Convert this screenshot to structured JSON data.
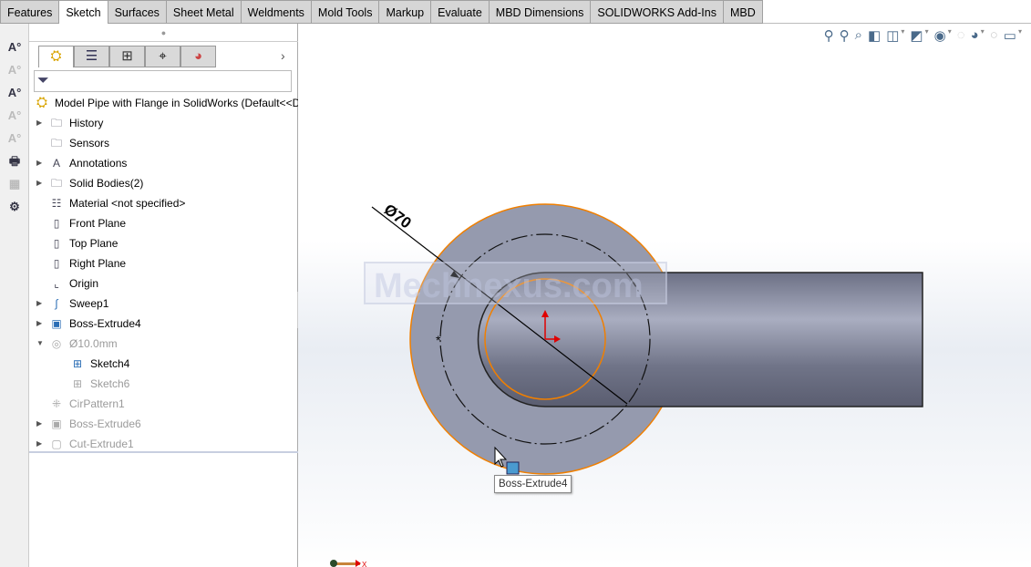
{
  "tabs": [
    "Features",
    "Sketch",
    "Surfaces",
    "Sheet Metal",
    "Weldments",
    "Mold Tools",
    "Markup",
    "Evaluate",
    "MBD Dimensions",
    "SOLIDWORKS Add-Ins",
    "MBD"
  ],
  "active_tab": "Sketch",
  "left_toolbar": [
    "smart-dimension-icon",
    "auto-dimension-icon",
    "import-annotations-icon",
    "annotation-icon",
    "note-icon",
    "print-icon",
    "datum-icon",
    "tolerance-icon"
  ],
  "panel_tabs": [
    "featuremanager-icon",
    "propertymanager-icon",
    "configurationmanager-icon",
    "dimxpertmanager-icon",
    "displaymanager-icon"
  ],
  "tree": {
    "root": "Model Pipe with Flange in SolidWorks  (Default<<D",
    "items": [
      {
        "label": "History",
        "icon": "history-folder-icon",
        "expand": true,
        "grey": false,
        "indent": 0
      },
      {
        "label": "Sensors",
        "icon": "sensors-folder-icon",
        "expand": false,
        "grey": false,
        "indent": 0
      },
      {
        "label": "Annotations",
        "icon": "annotations-folder-icon",
        "expand": true,
        "grey": false,
        "indent": 0
      },
      {
        "label": "Solid Bodies(2)",
        "icon": "solid-bodies-folder-icon",
        "expand": true,
        "grey": false,
        "indent": 0
      },
      {
        "label": "Material <not specified>",
        "icon": "material-icon",
        "expand": false,
        "grey": false,
        "indent": 0
      },
      {
        "label": "Front Plane",
        "icon": "plane-icon",
        "expand": false,
        "grey": false,
        "indent": 0
      },
      {
        "label": "Top Plane",
        "icon": "plane-icon",
        "expand": false,
        "grey": false,
        "indent": 0
      },
      {
        "label": "Right Plane",
        "icon": "plane-icon",
        "expand": false,
        "grey": false,
        "indent": 0
      },
      {
        "label": "Origin",
        "icon": "origin-icon",
        "expand": false,
        "grey": false,
        "indent": 0
      },
      {
        "label": "Sweep1",
        "icon": "sweep-icon",
        "expand": true,
        "grey": false,
        "indent": 0
      },
      {
        "label": "Boss-Extrude4",
        "icon": "extrude-icon",
        "expand": true,
        "grey": false,
        "indent": 0
      },
      {
        "label": "Ø10.0mm",
        "icon": "hole-icon",
        "expand": true,
        "grey": true,
        "indent": 0
      },
      {
        "label": "Sketch4",
        "icon": "sketch-icon",
        "expand": false,
        "grey": false,
        "indent": 1
      },
      {
        "label": "Sketch6",
        "icon": "sketch-icon",
        "expand": false,
        "grey": true,
        "indent": 1
      },
      {
        "label": "CirPattern1",
        "icon": "circular-pattern-icon",
        "expand": false,
        "grey": true,
        "indent": 0
      },
      {
        "label": "Boss-Extrude6",
        "icon": "extrude-icon",
        "expand": true,
        "grey": true,
        "indent": 0
      },
      {
        "label": "Cut-Extrude1",
        "icon": "cut-extrude-icon",
        "expand": true,
        "grey": true,
        "indent": 0
      }
    ]
  },
  "viewport": {
    "dimension": "Ø70",
    "watermark": "Mechnexus.com",
    "tooltip": "Boss-Extrude4",
    "triad_x": "X",
    "view_tools": [
      "zoom-to-fit-icon",
      "zoom-to-area-icon",
      "previous-view-icon",
      "section-view-icon",
      "view-orientation-icon",
      "display-style-icon",
      "hide-show-icon",
      "edit-appearance-icon",
      "apply-scene-icon",
      "realview-icon",
      "view-settings-icon"
    ]
  },
  "colors": {
    "accent": "#f07f00",
    "body": "#8e92a8",
    "axis": "#e00000"
  }
}
